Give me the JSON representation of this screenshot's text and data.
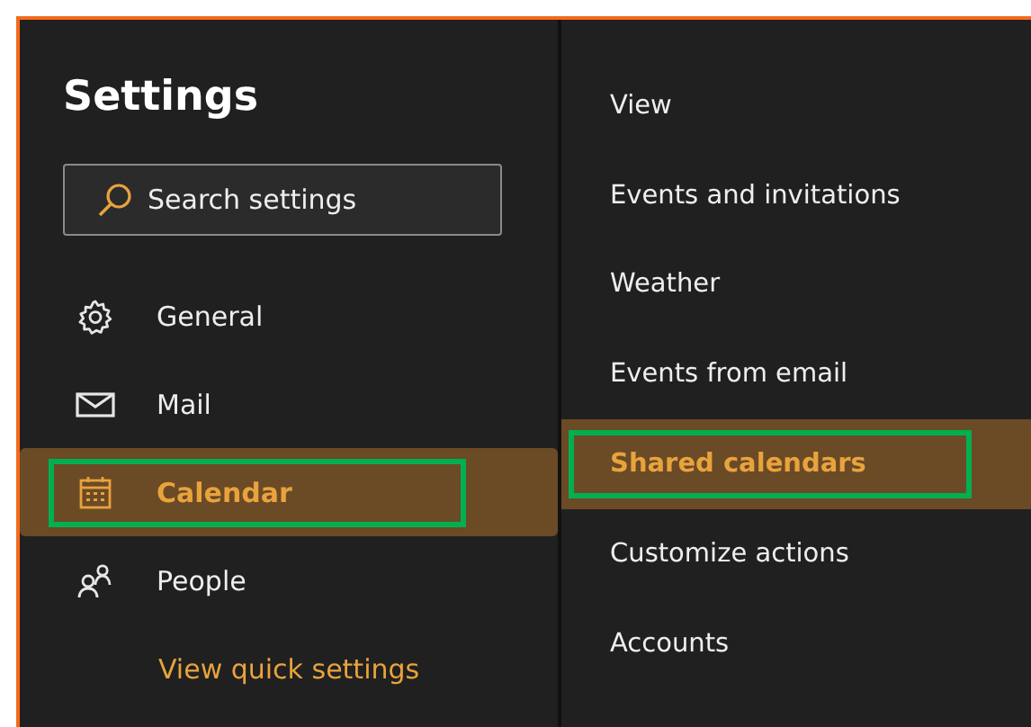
{
  "title": "Settings",
  "search": {
    "placeholder": "Search settings"
  },
  "nav": [
    {
      "kind": "gear",
      "label": "General",
      "selected": false,
      "outlined": false
    },
    {
      "kind": "mail",
      "label": "Mail",
      "selected": false,
      "outlined": false
    },
    {
      "kind": "calendar",
      "label": "Calendar",
      "selected": true,
      "outlined": true
    },
    {
      "kind": "people",
      "label": "People",
      "selected": false,
      "outlined": false
    }
  ],
  "quick_link": "View quick settings",
  "sections": [
    {
      "label": "View",
      "selected": false,
      "outlined": false
    },
    {
      "label": "Events and invitations",
      "selected": false,
      "outlined": false
    },
    {
      "label": "Weather",
      "selected": false,
      "outlined": false
    },
    {
      "label": "Events from email",
      "selected": false,
      "outlined": false
    },
    {
      "label": "Shared calendars",
      "selected": true,
      "outlined": true
    },
    {
      "label": "Customize actions",
      "selected": false,
      "outlined": false
    },
    {
      "label": "Accounts",
      "selected": false,
      "outlined": false
    }
  ]
}
